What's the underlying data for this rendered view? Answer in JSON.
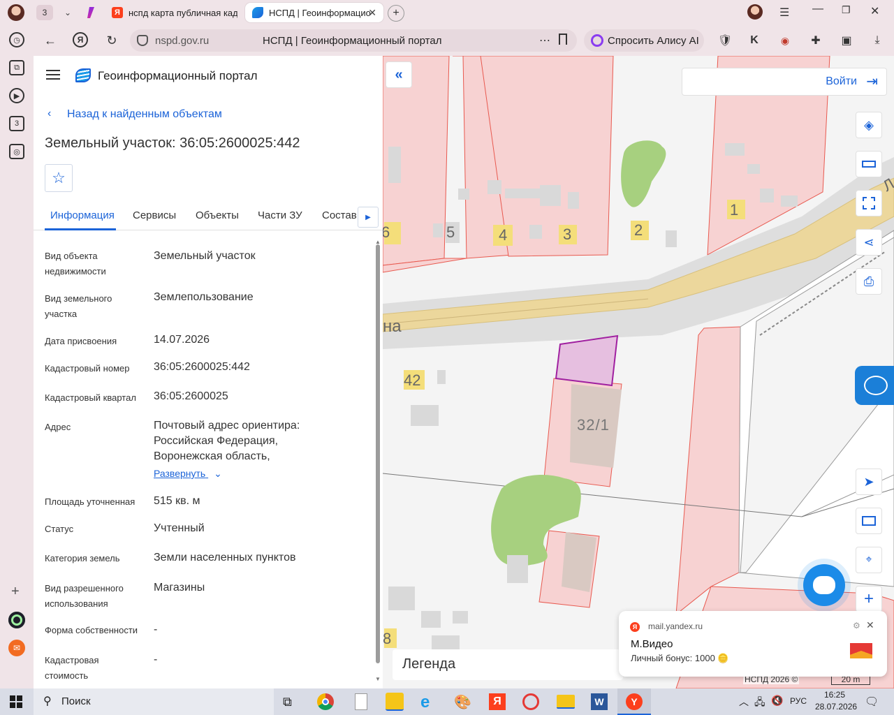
{
  "browser": {
    "tabs": [
      {
        "label": "нспд карта публичная кад"
      },
      {
        "label": "НСПД | Геоинформацио"
      }
    ],
    "tab_counter": "3",
    "url": "nspd.gov.ru",
    "page_title": "НСПД | Геоинформационный портал",
    "alice_label": "Спросить Алису AI"
  },
  "sidebar": {
    "badge": "3"
  },
  "portal": {
    "title": "Геоинформационный портал",
    "back_link": "Назад к найденным объектам",
    "object_title": "Земельный участок: 36:05:2600025:442",
    "tabs": [
      "Информация",
      "Сервисы",
      "Объекты",
      "Части ЗУ",
      "Состав"
    ],
    "active_tab": "Информация",
    "fields": [
      {
        "label": "Вид объекта недвижимости",
        "value": "Земельный участок"
      },
      {
        "label": "Вид земельного участка",
        "value": "Землепользование"
      },
      {
        "label": "Дата присвоения",
        "value": "14.07.2026"
      },
      {
        "label": "Кадастровый номер",
        "value": "36:05:2600025:442"
      },
      {
        "label": "Кадастровый квартал",
        "value": "36:05:2600025"
      },
      {
        "label": "Адрес",
        "value": "Почтовый адрес ориентира: Российская Федерация, Воронежская область,"
      },
      {
        "label": "Площадь уточненная",
        "value": "515 кв. м"
      },
      {
        "label": "Статус",
        "value": "Учтенный"
      },
      {
        "label": "Категория земель",
        "value": "Земли населенных пунктов"
      },
      {
        "label": "Вид разрешенного использования",
        "value": "Магазины"
      },
      {
        "label": "Форма собственности",
        "value": "-"
      },
      {
        "label": "Кадастровая стоимость",
        "value": "-"
      }
    ],
    "expand_link": "Развернуть"
  },
  "map": {
    "login": "Войти",
    "legend": "Легенда",
    "copyright": "НСПД 2026 ©",
    "scale": "20 m",
    "labels": [
      "6",
      "5",
      "4",
      "3",
      "2",
      "1",
      "42",
      "32/1",
      "на",
      "Л",
      "8"
    ]
  },
  "notification": {
    "source": "mail.yandex.ru",
    "title": "М.Видео",
    "body": "Личный бонус: 1000 🪙"
  },
  "taskbar": {
    "search": "Поиск",
    "lang": "РУС",
    "time": "16:25",
    "date": "28.07.2026"
  },
  "colors": {
    "accent": "#1b63d8",
    "parcel_fill": "#e6bfe0",
    "parcel_stroke": "#a020a0",
    "lot_fill": "#f7d2d2",
    "lot_stroke": "#e8594f",
    "road": "#e8d49a",
    "green": "#a7d07f"
  }
}
